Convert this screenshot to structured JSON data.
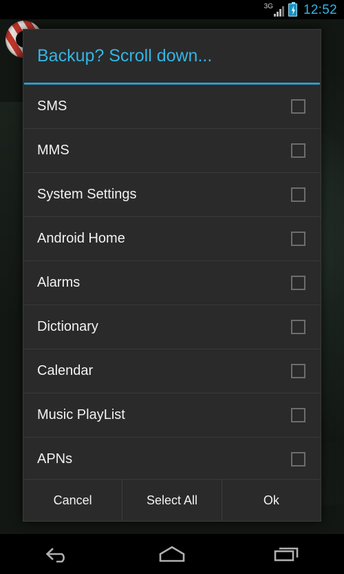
{
  "statusbar": {
    "network_label": "3G",
    "clock": "12:52",
    "signal_icon": "signal-bars-icon",
    "battery_icon": "battery-charging-icon",
    "clock_color": "#33b5e5"
  },
  "dialog": {
    "title": "Backup? Scroll down...",
    "accent_color": "#33b5e5",
    "background_color": "#2a2a2a",
    "rows": [
      {
        "label": "SMS",
        "checked": false
      },
      {
        "label": "MMS",
        "checked": false
      },
      {
        "label": "System Settings",
        "checked": false
      },
      {
        "label": "Android Home",
        "checked": false
      },
      {
        "label": "Alarms",
        "checked": false
      },
      {
        "label": "Dictionary",
        "checked": false
      },
      {
        "label": "Calendar",
        "checked": false
      },
      {
        "label": "Music PlayList",
        "checked": false
      },
      {
        "label": "APNs",
        "checked": false
      }
    ],
    "buttons": {
      "cancel": "Cancel",
      "select_all": "Select All",
      "ok": "Ok"
    }
  },
  "navbar": {
    "back": "back-icon",
    "home": "home-icon",
    "recents": "recents-icon"
  }
}
